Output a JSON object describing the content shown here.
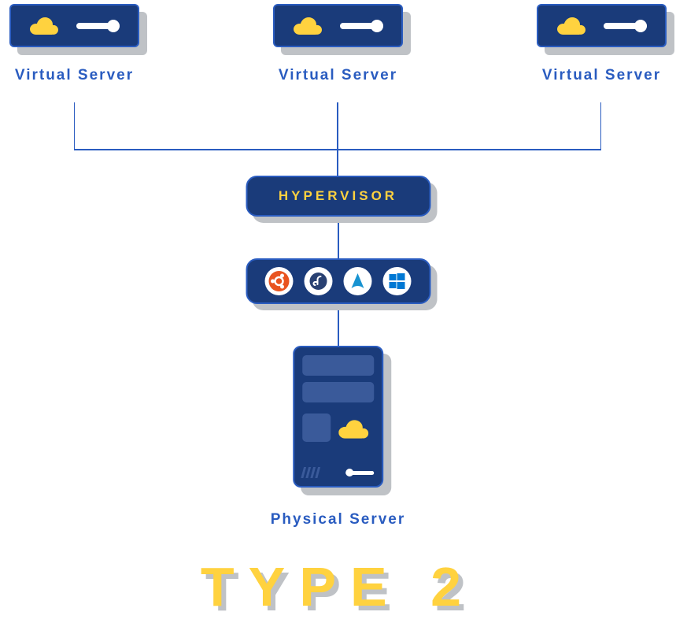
{
  "diagram": {
    "virtual_servers": [
      {
        "label": "Virtual Server"
      },
      {
        "label": "Virtual Server"
      },
      {
        "label": "Virtual Server"
      }
    ],
    "hypervisor_label": "HYPERVISOR",
    "os_icons": [
      {
        "name": "ubuntu",
        "color": "#e95420"
      },
      {
        "name": "fedora",
        "color": "#294172"
      },
      {
        "name": "arch",
        "color": "#1793d1"
      },
      {
        "name": "windows",
        "color": "#0078d4"
      }
    ],
    "physical_server_label": "Physical Server",
    "title": "TYPE 2",
    "colors": {
      "primary_blue": "#1a3b7a",
      "accent_blue": "#2a5cc0",
      "yellow": "#ffd23f",
      "shadow": "#bfc2c6"
    }
  }
}
